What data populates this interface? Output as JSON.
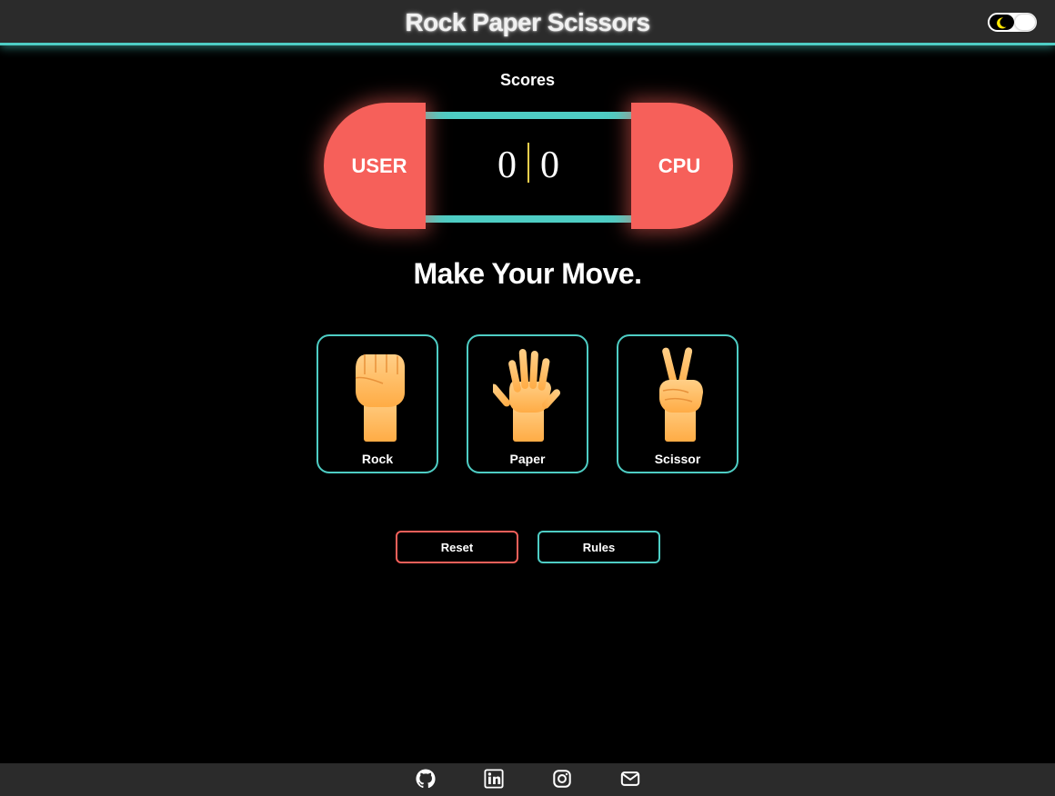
{
  "header": {
    "title": "Rock Paper Scissors",
    "theme_toggle": {
      "icon": "moon-icon",
      "state": "dark"
    }
  },
  "scoreboard": {
    "label": "Scores",
    "user_label": "USER",
    "cpu_label": "CPU",
    "user_score": "0",
    "cpu_score": "0"
  },
  "main": {
    "prompt": "Make Your Move.",
    "choices": [
      {
        "label": "Rock",
        "icon": "fist-icon"
      },
      {
        "label": "Paper",
        "icon": "open-hand-icon"
      },
      {
        "label": "Scissor",
        "icon": "victory-hand-icon"
      }
    ]
  },
  "actions": {
    "reset_label": "Reset",
    "rules_label": "Rules"
  },
  "footer": {
    "icons": [
      "github-icon",
      "linkedin-icon",
      "instagram-icon",
      "mail-icon"
    ]
  },
  "colors": {
    "accent": "#4ecdc4",
    "danger": "#f6605a",
    "bar": "#2b2b2b",
    "hand": "#ffb55c"
  }
}
